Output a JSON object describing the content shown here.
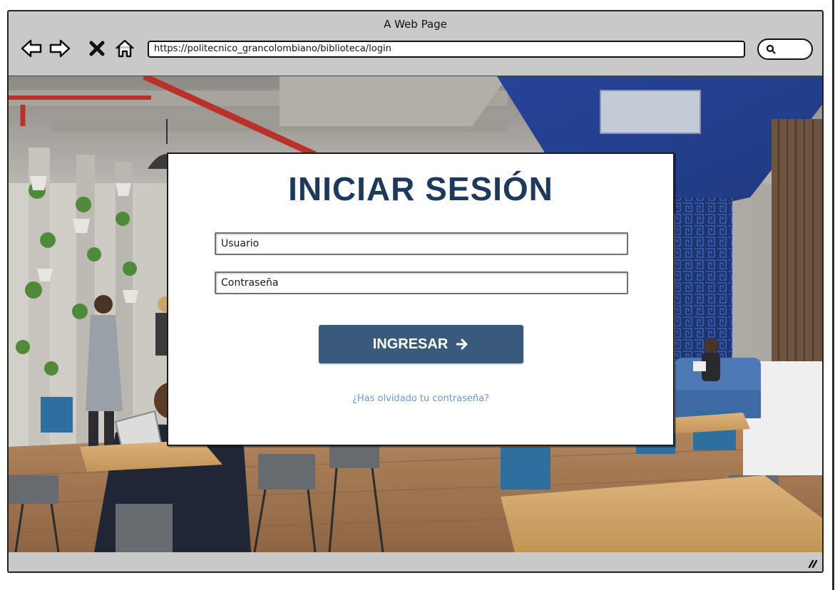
{
  "browser": {
    "window_title": "A Web Page",
    "url": "https://politecnico_grancolombiano/biblioteca/login",
    "nav_icons": [
      "back-arrow-icon",
      "forward-arrow-icon",
      "stop-icon",
      "home-icon"
    ],
    "search_icon": "search-icon"
  },
  "background": {
    "description_icon": "library-interior-photo"
  },
  "login": {
    "title": "INICIAR SESIÓN",
    "username_placeholder": "Usuario",
    "password_placeholder": "Contraseña",
    "submit_label": "INGRESAR",
    "forgot_password": "¿Has olvidado tu contraseña?"
  },
  "colors": {
    "title": "#1d3a5c",
    "button": "#3a5a7c",
    "link": "#6a9acf",
    "chrome": "#c9c9c9"
  }
}
